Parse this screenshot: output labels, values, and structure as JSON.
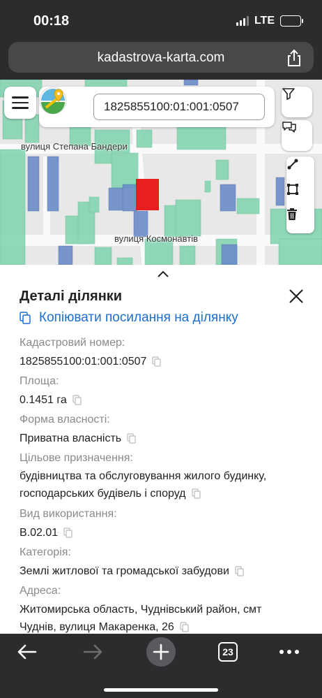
{
  "status_bar": {
    "time": "00:18",
    "network": "LTE",
    "battery_level": 0.6
  },
  "browser": {
    "url": "kadastrova-karta.com"
  },
  "map": {
    "search_value": "1825855100:01:001:0507",
    "street_labels": [
      "вулиця Степана Бандери",
      "вулиця Космонавтів"
    ],
    "icons": [
      "menu-icon",
      "logo-icon",
      "filter-icon",
      "chat-icon",
      "line-tool-icon",
      "square-tool-icon",
      "trash-icon"
    ]
  },
  "details": {
    "title": "Деталі ділянки",
    "copy_link": "Копіювати посилання на ділянку",
    "fields": [
      {
        "label": "Кадастровий номер:",
        "value": "1825855100:01:001:0507"
      },
      {
        "label": "Площа:",
        "value": "0.1451 га"
      },
      {
        "label": "Форма власності:",
        "value": "Приватна власність"
      },
      {
        "label": "Цільове призначення:",
        "value_lines": [
          "будівництва та обслуговування жилого будинку,",
          "господарських будівель і споруд"
        ]
      },
      {
        "label": "Вид використання:",
        "value": "В.02.01"
      },
      {
        "label": "Категорія:",
        "value": "Землі житлової та громадської забудови"
      },
      {
        "label": "Адреса:",
        "value_lines": [
          "Житомирська область, Чуднівський район, смт",
          "Чуднів, вулиця Макаренка, 26"
        ]
      }
    ]
  },
  "toolbar": {
    "tab_count": "23"
  },
  "colors": {
    "parcel_green": "#7fd3ae",
    "parcel_blue": "#6b8cc8",
    "selected_parcel": "#e81f1f",
    "link_blue": "#1a6fd0"
  }
}
